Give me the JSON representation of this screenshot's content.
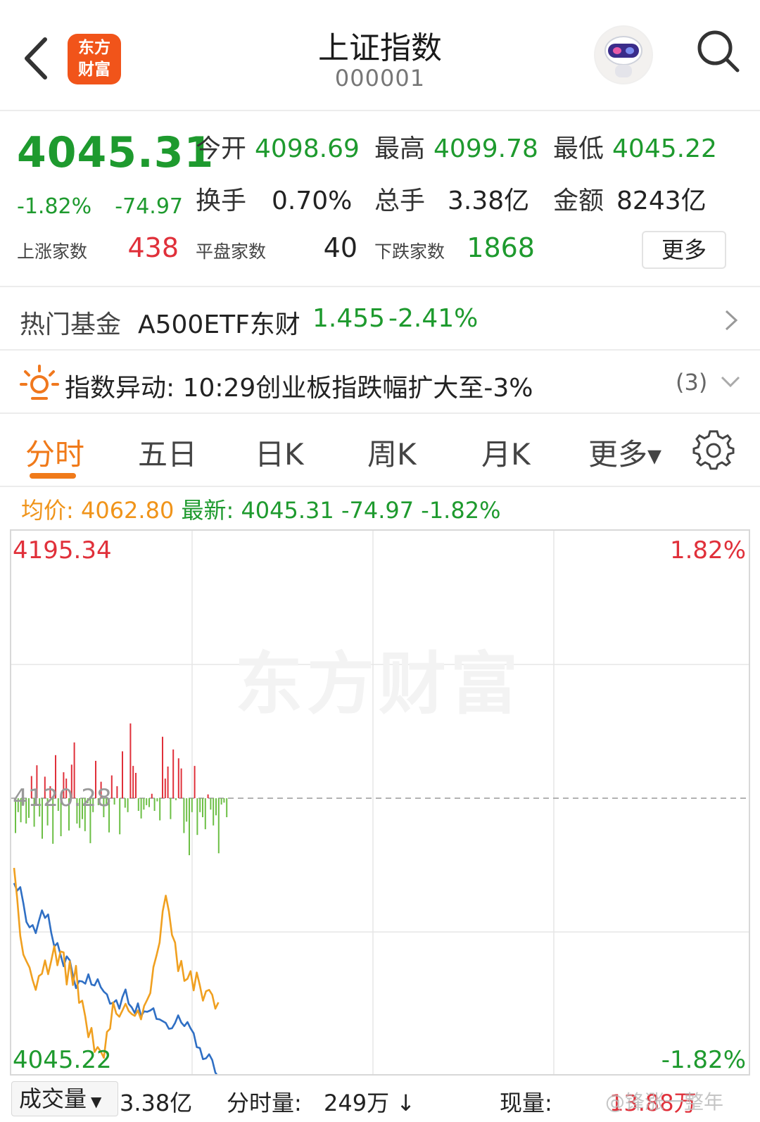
{
  "header": {
    "title": "上证指数",
    "code": "000001",
    "logo_line1": "东方",
    "logo_line2": "财富"
  },
  "quote": {
    "price": "4045.31",
    "change_pct": "-1.82%",
    "change": "-74.97",
    "open_label": "今开",
    "open": "4098.69",
    "high_label": "最高",
    "high": "4099.78",
    "low_label": "最低",
    "low": "4045.22",
    "turnover_label": "换手",
    "turnover": "0.70%",
    "volume_label": "总手",
    "volume": "3.38亿",
    "amount_label": "金额",
    "amount": "8243亿",
    "up_label": "上涨家数",
    "up_count": "438",
    "flat_label": "平盘家数",
    "flat_count": "40",
    "down_label": "下跌家数",
    "down_count": "1868",
    "more_label": "更多"
  },
  "fund": {
    "label": "热门基金",
    "name": "A500ETF东财",
    "price": "1.455",
    "change": "-2.41%"
  },
  "alert": {
    "label": "指数异动:",
    "text": "10:29创业板指跌幅扩大至-3%",
    "count": "(3)"
  },
  "tabs": [
    "分时",
    "五日",
    "日K",
    "周K",
    "月K",
    "更多"
  ],
  "price_line": {
    "avg_label": "均价:",
    "avg": "4062.80",
    "latest_label": "最新:",
    "latest": "4045.31 -74.97 -1.82%"
  },
  "chart": {
    "top_price": "4195.34",
    "top_pct": "1.82%",
    "mid_price": "4120.28",
    "bottom_price": "4045.22",
    "bottom_pct": "-1.82%",
    "watermark": "东方财富"
  },
  "chart_data": {
    "type": "line",
    "ylim": [
      4045.22,
      4195.34
    ],
    "reference": 4120.28,
    "series": [
      {
        "name": "最新",
        "color": "#2f6fc4",
        "values": [
          4088.6,
          4086.9,
          4087.7,
          4084.1,
          4079.9,
          4078.7,
          4079.2,
          4077.4,
          4080.1,
          4082.5,
          4080.8,
          4081.6,
          4077.5,
          4074.4,
          4075.2,
          4072.6,
          4070.0,
          4072.2,
          4071.3,
          4067.9,
          4065.1,
          4066.7,
          4066.6,
          4066.1,
          4068.2,
          4065.9,
          4065.7,
          4067.1,
          4065.3,
          4064.3,
          4063.7,
          4061.6,
          4061.8,
          4062.4,
          4060.5,
          4063.1,
          4064.8,
          4061.6,
          4060.8,
          4059.5,
          4061.7,
          4058.8,
          4059.9,
          4059.8,
          4060.1,
          4060.6,
          4058.2,
          4058.1,
          4057.7,
          4057.3,
          4056.0,
          4056.1,
          4057.3,
          4059.0,
          4057.4,
          4056.6,
          4057.5,
          4056.1,
          4055.0,
          4051.9,
          4051.7,
          4049.2,
          4049.4,
          4050.3,
          4049.0,
          4046.2,
          4045.22
        ]
      },
      {
        "name": "均价",
        "color": "#f0a020",
        "values": [
          4092.0,
          4085.2,
          4076.8,
          4072.6,
          4071.1,
          4069.7,
          4066.9,
          4064.7,
          4067.8,
          4068.3,
          4071.3,
          4068.2,
          4071.2,
          4074.5,
          4070.2,
          4073.3,
          4073.1,
          4065.9,
          4071.1,
          4065.8,
          4070.1,
          4061.8,
          4062.3,
          4058.7,
          4054.1,
          4056.2,
          4050.8,
          4051.9,
          4050.9,
          4049.5,
          4055.3,
          4056.0,
          4061.9,
          4059.4,
          4058.7,
          4060.1,
          4061.6,
          4060.0,
          4059.3,
          4058.9,
          4060.1,
          4058.1,
          4061.1,
          4062.5,
          4064.0,
          4069.8,
          4072.4,
          4075.3,
          4082.3,
          4085.8,
          4082.3,
          4077.0,
          4075.3,
          4068.9,
          4071.2,
          4066.7,
          4067.2,
          4068.9,
          4064.6,
          4068.6,
          4065.7,
          4062.3,
          4064.4,
          4064.7,
          4063.6,
          4060.5,
          4061.9
        ]
      }
    ],
    "volume_bars": {
      "description_values_relative": "positive=red up, negative=green down, relative to reference",
      "values": [
        -0.55,
        -0.22,
        -0.38,
        -0.1,
        -0.4,
        -0.31,
        0.35,
        -0.45,
        0.52,
        -0.29,
        -0.64,
        0.34,
        -0.43,
        0.19,
        -0.72,
        0.68,
        -0.2,
        -0.6,
        0.41,
        0.31,
        -0.51,
        0.53,
        0.88,
        -0.4,
        -0.47,
        -0.33,
        -0.52,
        -0.08,
        -0.71,
        -0.22,
        0.59,
        -0.11,
        0.26,
        -0.3,
        -0.12,
        -0.54,
        0.36,
        -0.1,
        0.19,
        -0.57,
        0.74,
        -0.15,
        -0.22,
        1.18,
        0.51,
        0.4,
        -0.2,
        -0.32,
        -0.18,
        -0.11,
        -0.14,
        0.07,
        -0.2,
        -0.05,
        -0.35,
        0.97,
        0.31,
        0.5,
        -0.33,
        0.77,
        -0.03,
        0.63,
        0.47,
        -0.55,
        -0.37,
        -0.9,
        -0.22,
        0.51,
        -0.58,
        -0.22,
        -0.3,
        -0.49,
        0.06,
        -0.18,
        -0.43,
        -0.27,
        -0.87,
        -0.1,
        -0.07,
        -0.3
      ]
    }
  },
  "footer": {
    "volume_label": "成交量",
    "volume": "3.38亿",
    "period_label": "分时量:",
    "period_volume": "249万",
    "period_arrow": "↓",
    "current_label": "现量:",
    "current": "13.88万",
    "weibo": "@锋涨一整年"
  },
  "colors": {
    "up": "#e0303a",
    "down": "#1e9a2e",
    "accent": "#f07a1a",
    "price_line": "#2f6fc4",
    "avg_line": "#f0a020"
  }
}
